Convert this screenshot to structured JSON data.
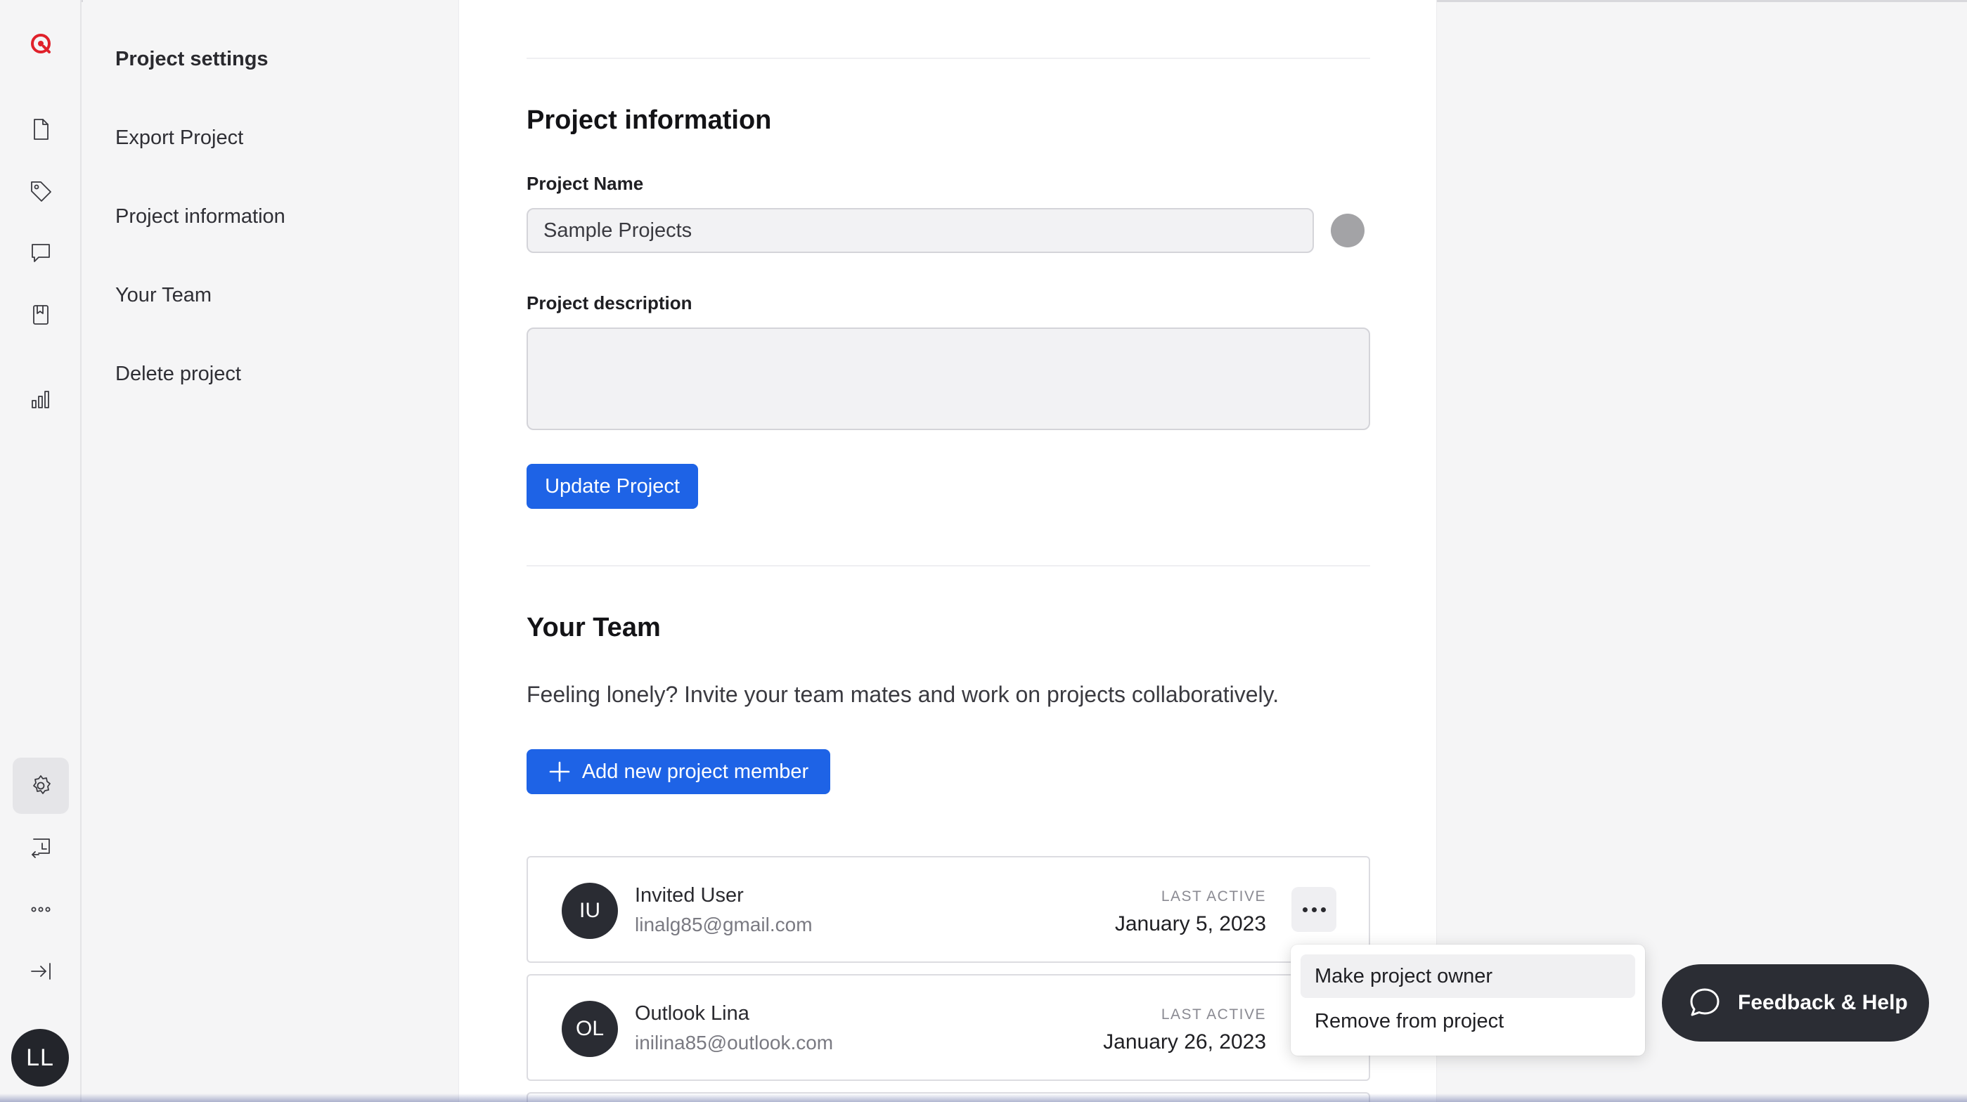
{
  "sidebar": {
    "title": "Project settings",
    "items": [
      {
        "label": "Export Project"
      },
      {
        "label": "Project information"
      },
      {
        "label": "Your Team"
      },
      {
        "label": "Delete project"
      }
    ]
  },
  "rail": {
    "icons": [
      "logo-icon",
      "document-icon",
      "tag-icon",
      "comment-icon",
      "bookmark-icon",
      "chart-icon",
      "settings-icon",
      "import-icon",
      "more-icon",
      "collapse-icon"
    ],
    "active": "settings-icon",
    "user_initials": "LL",
    "accent_color": "#e0212b"
  },
  "project_info": {
    "heading": "Project information",
    "name_label": "Project Name",
    "name_value": "Sample Projects",
    "project_color": "#a3a3a6",
    "description_label": "Project description",
    "description_value": "",
    "update_button": "Update Project"
  },
  "team": {
    "heading": "Your Team",
    "description": "Feeling lonely? Invite your team mates and work on projects collaboratively.",
    "add_button": "Add new project member",
    "last_active_label": "LAST ACTIVE",
    "members": [
      {
        "initials": "IU",
        "name": "Invited User",
        "email": "linalg85@gmail.com",
        "last_active": "January 5, 2023"
      },
      {
        "initials": "OL",
        "name": "Outlook Lina",
        "email": "inilina85@outlook.com",
        "last_active": "January 26, 2023"
      }
    ]
  },
  "member_menu": {
    "items": [
      {
        "label": "Make project owner"
      },
      {
        "label": "Remove from project"
      }
    ]
  },
  "feedback": {
    "label": "Feedback & Help"
  },
  "colors": {
    "primary": "#1e63e6",
    "dark": "#2b2d34"
  }
}
